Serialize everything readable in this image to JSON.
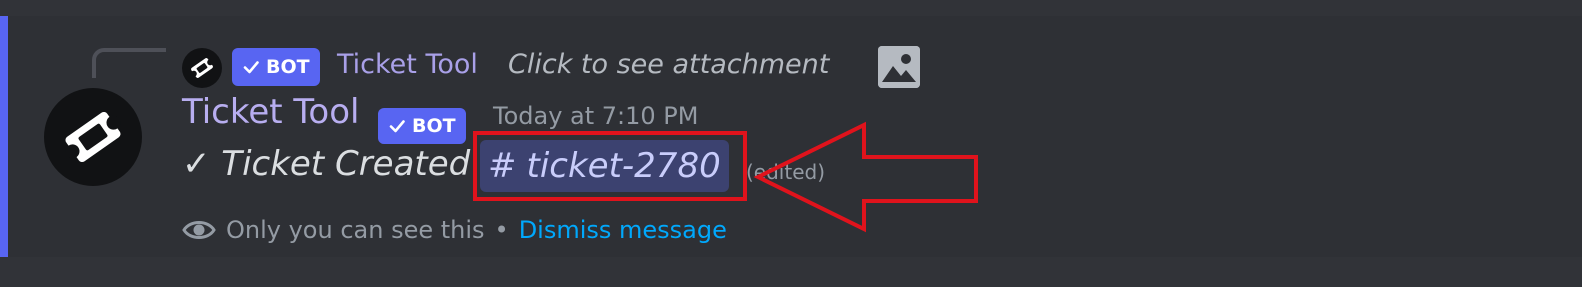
{
  "reply": {
    "bot_tag": "BOT",
    "author": "Ticket Tool",
    "preview": "Click to see attachment",
    "attachment_icon": "image-icon"
  },
  "message": {
    "author": "Ticket Tool",
    "bot_tag": "BOT",
    "timestamp": "Today at 7:10 PM",
    "content_prefix": "✓ Ticket Created",
    "channel_mention": {
      "hash": "#",
      "name": "ticket-2780"
    },
    "edited_label": "(edited)",
    "ephemeral": {
      "text": "Only you can see this",
      "separator": "•",
      "dismiss_label": "Dismiss message"
    }
  },
  "annotation": {
    "color": "#e0131c"
  },
  "colors": {
    "accent": "#5865f2",
    "author": "#b8aef0",
    "link": "#00a8fc",
    "mention_bg": "#3c4270"
  }
}
